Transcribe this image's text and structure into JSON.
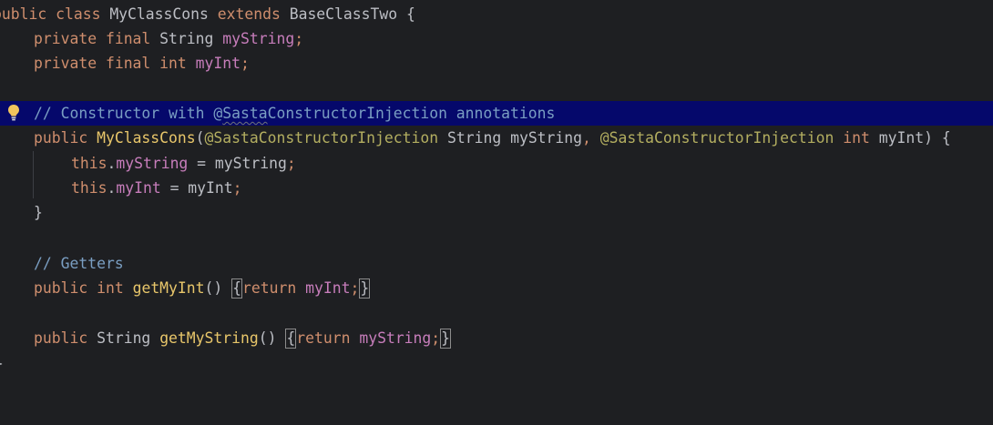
{
  "editor": {
    "lines": {
      "l1": {
        "kw_public": "public",
        "kw_class": "class",
        "class_name": "MyClassCons",
        "kw_extends": "extends",
        "base": "BaseClassTwo",
        "brace": " {"
      },
      "l2": {
        "kw_private": "private",
        "kw_final": "final",
        "type": "String",
        "field": "myString",
        "semi": ";"
      },
      "l3": {
        "kw_private": "private",
        "kw_final": "final",
        "type": "int",
        "field": "myInt",
        "semi": ";"
      },
      "l5": {
        "comment_start": "// Constructor with @",
        "comment_link": "Sasta",
        "comment_end": "ConstructorInjection annotations"
      },
      "l6": {
        "kw_public": "public",
        "ctor": "MyClassCons",
        "open": "(",
        "ann1": "@SastaConstructorInjection",
        "type1": "String",
        "param1": "myString",
        "comma": ",",
        "ann2": "@SastaConstructorInjection",
        "kw_int": "int",
        "param2": "myInt",
        "close": ") {"
      },
      "l7": {
        "kw_this": "this",
        "dot": ".",
        "field": "myString",
        "assign": " = myString",
        "semi": ";"
      },
      "l8": {
        "kw_this": "this",
        "dot": ".",
        "field": "myInt",
        "assign": " = myInt",
        "semi": ";"
      },
      "l9": {
        "brace": "}"
      },
      "l11": {
        "comment": "// Getters"
      },
      "l12": {
        "kw_public": "public",
        "kw_int": "int",
        "method": "getMyInt",
        "parens": "()",
        "open": "{",
        "kw_return": "return",
        "field": "myInt",
        "semi": ";",
        "close": "}"
      },
      "l14": {
        "kw_public": "public",
        "type": "String",
        "method": "getMyString",
        "parens": "()",
        "open": "{",
        "kw_return": "return",
        "field": "myString",
        "semi": ";",
        "close": "}"
      },
      "l15": {
        "brace": "}"
      }
    },
    "colors": {
      "background": "#1e1f22",
      "highlight_line": "#05086b",
      "keyword": "#cf8e6d",
      "field": "#c77dbb",
      "annotation": "#b3ae60",
      "comment": "#7a9ec2",
      "method_decl": "#e8c66a",
      "default_text": "#bcbec4"
    },
    "gutter_icon": "lightbulb-icon"
  }
}
